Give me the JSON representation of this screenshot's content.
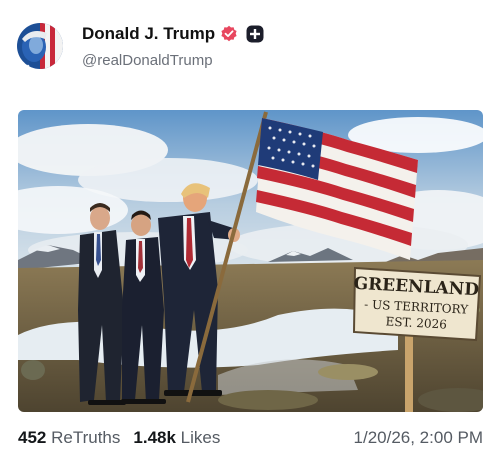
{
  "author": {
    "display_name": "Donald J. Trump",
    "handle": "@realDonaldTrump"
  },
  "media": {
    "sign_line1": "GREENLAND",
    "sign_line2": "- US TERRITORY",
    "sign_line3": "EST. 2026"
  },
  "stats": {
    "retruths_count": "452",
    "retruths_label": "ReTruths",
    "likes_count": "1.48k",
    "likes_label": "Likes"
  },
  "timestamp": "1/20/26, 2:00 PM",
  "colors": {
    "verified": "#e8475f",
    "text": "#14171a",
    "muted": "#6b7079"
  }
}
